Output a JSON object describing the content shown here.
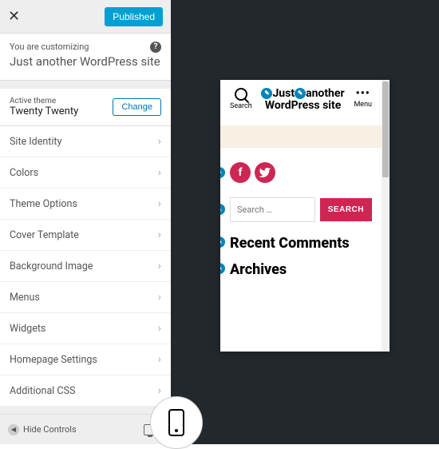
{
  "toolbar": {
    "publish_label": "Published"
  },
  "customizing": {
    "subtitle": "You are customizing",
    "title": "Just another WordPress site"
  },
  "theme_row": {
    "label": "Active theme",
    "name": "Twenty Twenty",
    "change_label": "Change"
  },
  "sections": [
    {
      "label": "Site Identity"
    },
    {
      "label": "Colors"
    },
    {
      "label": "Theme Options"
    },
    {
      "label": "Cover Template"
    },
    {
      "label": "Background Image"
    },
    {
      "label": "Menus"
    },
    {
      "label": "Widgets"
    },
    {
      "label": "Homepage Settings"
    },
    {
      "label": "Additional CSS"
    }
  ],
  "footer": {
    "hide_controls": "Hide Controls"
  },
  "preview": {
    "search_label": "Search",
    "menu_label": "Menu",
    "site_title_a": "Just",
    "site_title_b": "another WordPress site",
    "search_placeholder": "Search …",
    "search_button": "SEARCH",
    "heading_recent": "Recent Comments",
    "heading_archives": "Archives"
  },
  "colors": {
    "accent": "#cd2653",
    "wp_blue": "#0085ba"
  }
}
